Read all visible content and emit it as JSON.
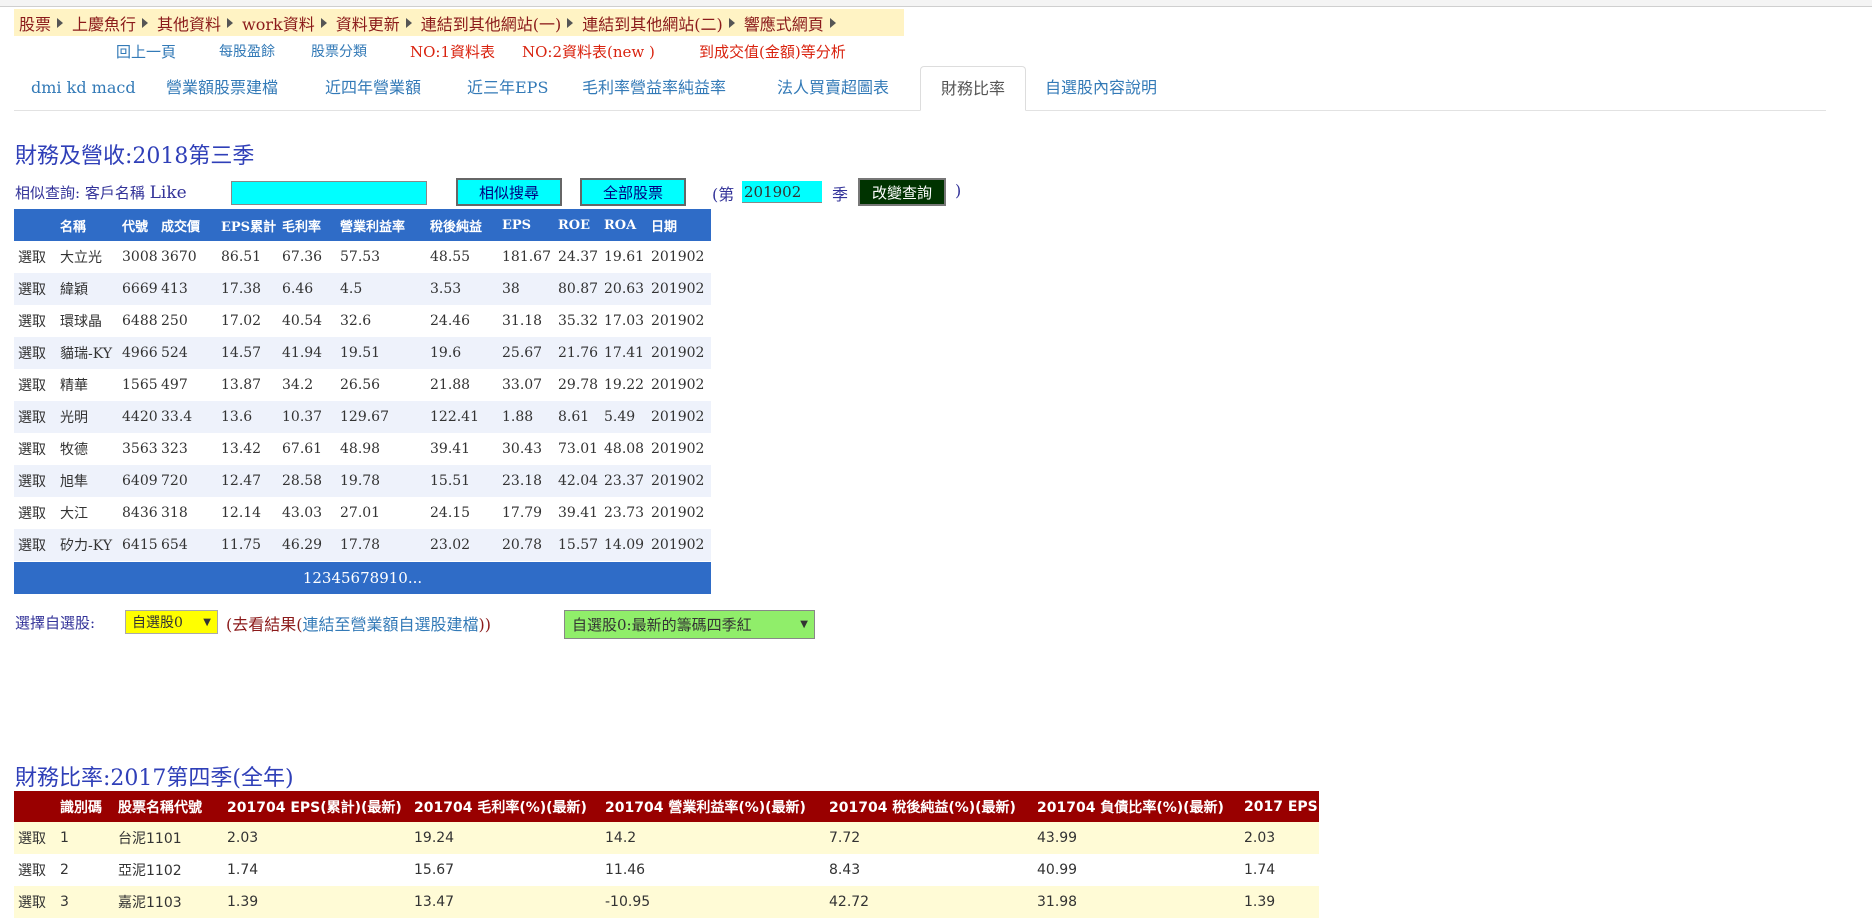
{
  "menu": [
    "股票",
    "上慶魚行",
    "其他資料",
    "work資料",
    "資料更新",
    "連結到其他網站(一)",
    "連結到其他網站(二)",
    "響應式網頁"
  ],
  "sublinks": {
    "back": "回上一頁",
    "daily_pl": "每股盈餘",
    "stock_class": "股票分類",
    "no1": "NO:1資料表",
    "no2": "NO:2資料表(new )",
    "volume_analysis": "到成交值(金額)等分析"
  },
  "tabs": [
    "dmi kd macd",
    "營業額股票建檔",
    "近四年營業額",
    "近三年EPS",
    "毛利率營益率純益率",
    "法人買賣超圖表",
    "財務比率",
    "自選股內容說明"
  ],
  "section1": {
    "title": "財務及營收:2018第三季",
    "query_label": "相似查詢: 客戶名稱 ",
    "like_word": "Like",
    "search_value": "",
    "similar_button": "相似搜尋",
    "all_button": "全部股票",
    "paren_open": "(第",
    "season_value": "201902",
    "season_suffix": "季",
    "change_button": "改變查詢",
    "paren_close": ")"
  },
  "table1": {
    "headers": [
      "",
      "名稱",
      "代號",
      "成交價",
      "EPS累計",
      "毛利率",
      "營業利益率",
      "稅後純益",
      "EPS",
      "ROE",
      "ROA",
      "日期"
    ],
    "select_label": "選取",
    "rows": [
      [
        "大立光",
        "3008",
        "3670",
        "86.51",
        "67.36",
        "57.53",
        "48.55",
        "181.67",
        "24.37",
        "19.61",
        "201902"
      ],
      [
        "緯穎",
        "6669",
        "413",
        "17.38",
        "6.46",
        "4.5",
        "3.53",
        "38",
        "80.87",
        "20.63",
        "201902"
      ],
      [
        "環球晶",
        "6488",
        "250",
        "17.02",
        "40.54",
        "32.6",
        "24.46",
        "31.18",
        "35.32",
        "17.03",
        "201902"
      ],
      [
        "貓瑞-KY",
        "4966",
        "524",
        "14.57",
        "41.94",
        "19.51",
        "19.6",
        "25.67",
        "21.76",
        "17.41",
        "201902"
      ],
      [
        "精華",
        "1565",
        "497",
        "13.87",
        "34.2",
        "26.56",
        "21.88",
        "33.07",
        "29.78",
        "19.22",
        "201902"
      ],
      [
        "光明",
        "4420",
        "33.4",
        "13.6",
        "10.37",
        "129.67",
        "122.41",
        "1.88",
        "8.61",
        "5.49",
        "201902"
      ],
      [
        "牧德",
        "3563",
        "323",
        "13.42",
        "67.61",
        "48.98",
        "39.41",
        "30.43",
        "73.01",
        "48.08",
        "201902"
      ],
      [
        "旭隼",
        "6409",
        "720",
        "12.47",
        "28.58",
        "19.78",
        "15.51",
        "23.18",
        "42.04",
        "23.37",
        "201902"
      ],
      [
        "大江",
        "8436",
        "318",
        "12.14",
        "43.03",
        "27.01",
        "24.15",
        "17.79",
        "39.41",
        "23.73",
        "201902"
      ],
      [
        "矽力-KY",
        "6415",
        "654",
        "11.75",
        "46.29",
        "17.78",
        "23.02",
        "20.78",
        "15.57",
        "14.09",
        "201902"
      ]
    ],
    "pager": "12345678910..."
  },
  "pick": {
    "label": "選擇自選股:",
    "select_value": "自選股0",
    "result_prefix": "(去看結果(",
    "result_link": "連結至營業額自選股建檔",
    "result_suffix": "))",
    "green_select": "自選股0:最新的籌碼四季紅"
  },
  "section2": {
    "title": "財務比率:2017第四季(全年)"
  },
  "table2": {
    "headers": [
      "",
      "識別碼",
      "股票名稱代號",
      "201704 EPS(累計)(最新)",
      "201704 毛利率(%)(最新)",
      "201704 營業利益率(%)(最新)",
      "201704 稅後純益(%)(最新)",
      "201704 負債比率(%)(最新)",
      "2017 EPS"
    ],
    "select_label": "選取",
    "rows": [
      [
        "1",
        "台泥1101",
        "2.03",
        "19.24",
        "14.2",
        "7.72",
        "43.99",
        "2.03"
      ],
      [
        "2",
        "亞泥1102",
        "1.74",
        "15.67",
        "11.46",
        "8.43",
        "40.99",
        "1.74"
      ],
      [
        "3",
        "嘉泥1103",
        "1.39",
        "13.47",
        "-10.95",
        "42.72",
        "31.98",
        "1.39"
      ]
    ]
  },
  "colors": {
    "menu_bg": "#fff3c4",
    "header_blue": "#2f6cc7",
    "header_red": "#990000",
    "cyan": "#00ffff",
    "dark_button": "#003300"
  }
}
